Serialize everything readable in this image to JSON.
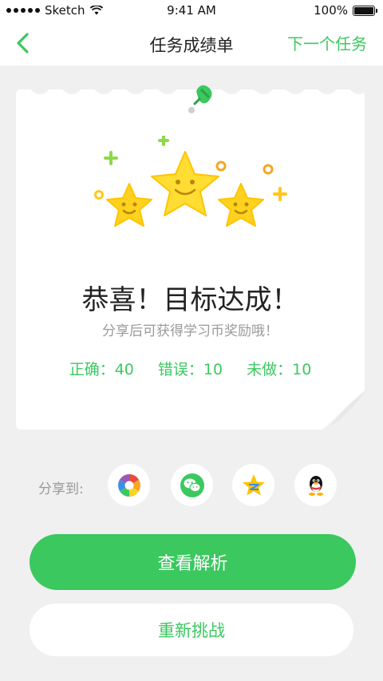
{
  "status_bar": {
    "carrier": "Sketch",
    "time": "9:41 AM",
    "battery": "100%"
  },
  "nav": {
    "back_icon": "chevron-left-icon",
    "title": "任务成绩单",
    "next_label": "下一个任务"
  },
  "result": {
    "headline": "恭喜！目标达成！",
    "subline": "分享后可获得学习币奖励哦！",
    "stats": [
      {
        "label": "正确：",
        "value": "40"
      },
      {
        "label": "错误：",
        "value": "10"
      },
      {
        "label": "未做：",
        "value": "10"
      }
    ]
  },
  "share": {
    "label": "分享到:",
    "targets": [
      {
        "icon": "camera-aperture-icon"
      },
      {
        "icon": "wechat-icon"
      },
      {
        "icon": "qzone-icon"
      },
      {
        "icon": "qq-penguin-icon"
      }
    ]
  },
  "actions": {
    "primary_label": "查看解析",
    "secondary_label": "重新挑战"
  },
  "colors": {
    "accent": "#3bc85f",
    "star": "#ffd21f"
  }
}
